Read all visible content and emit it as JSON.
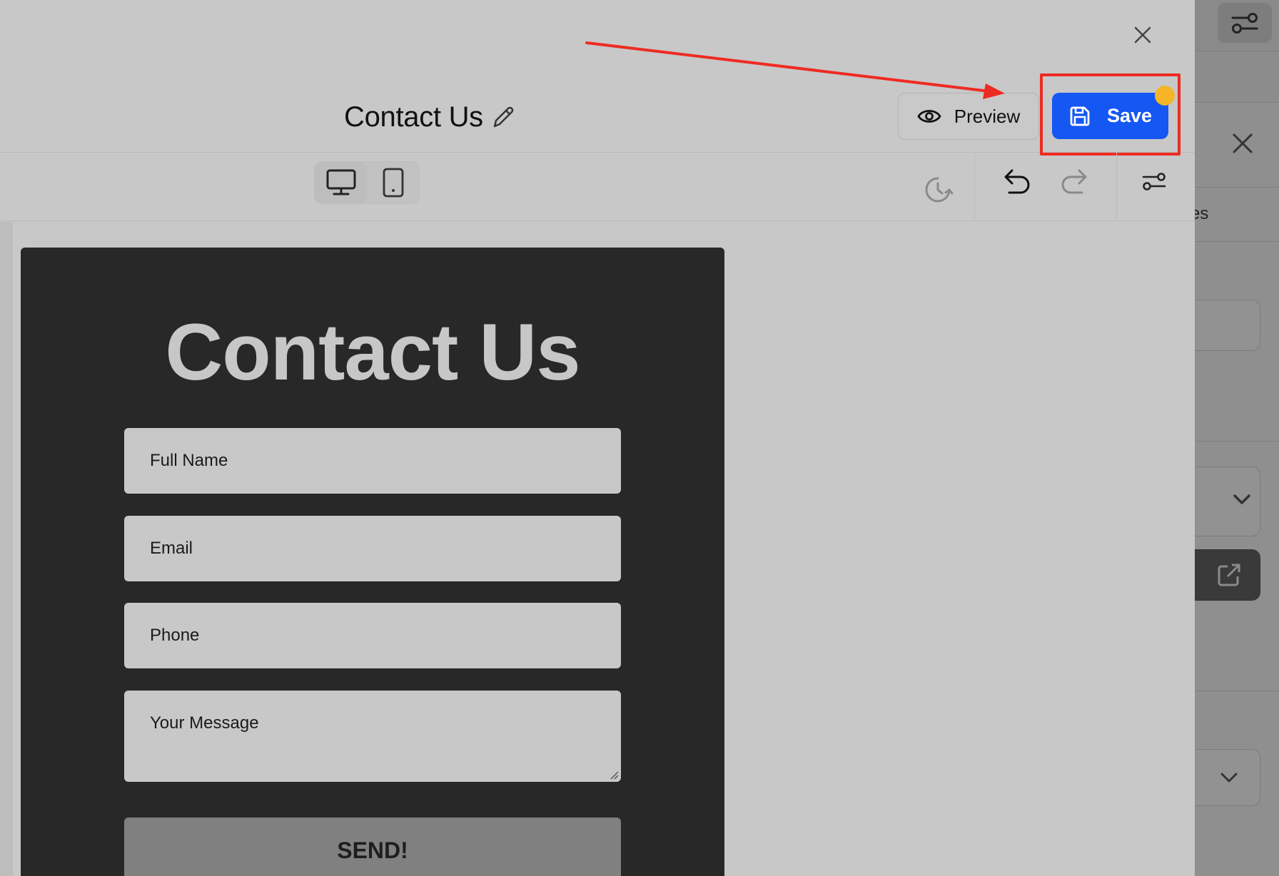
{
  "colors": {
    "overlay_bg": "#c8c8c8",
    "primary": "#1557f2",
    "annotation": "#ee2b22",
    "unsaved_dot": "#f6b526",
    "form_bg": "#282828",
    "field_bg": "#c8c8c8",
    "send_bg": "#808080"
  },
  "header": {
    "page_title": "Contact Us",
    "preview_label": "Preview",
    "save_label": "Save"
  },
  "toolbar": {
    "device_options": [
      "desktop",
      "tablet"
    ],
    "active_device": "desktop"
  },
  "form": {
    "heading": "Contact Us",
    "fields": {
      "full_name": "Full Name",
      "email": "Email",
      "phone": "Phone",
      "message": "Your Message"
    },
    "submit_label": "SEND!"
  },
  "background_panel": {
    "visible_text": "es"
  },
  "icons": [
    "close-icon",
    "pencil-icon",
    "eye-icon",
    "floppy-disk-icon",
    "desktop-icon",
    "tablet-icon",
    "history-icon",
    "undo-icon",
    "redo-icon",
    "sliders-icon",
    "chevron-down-icon",
    "external-link-icon"
  ]
}
